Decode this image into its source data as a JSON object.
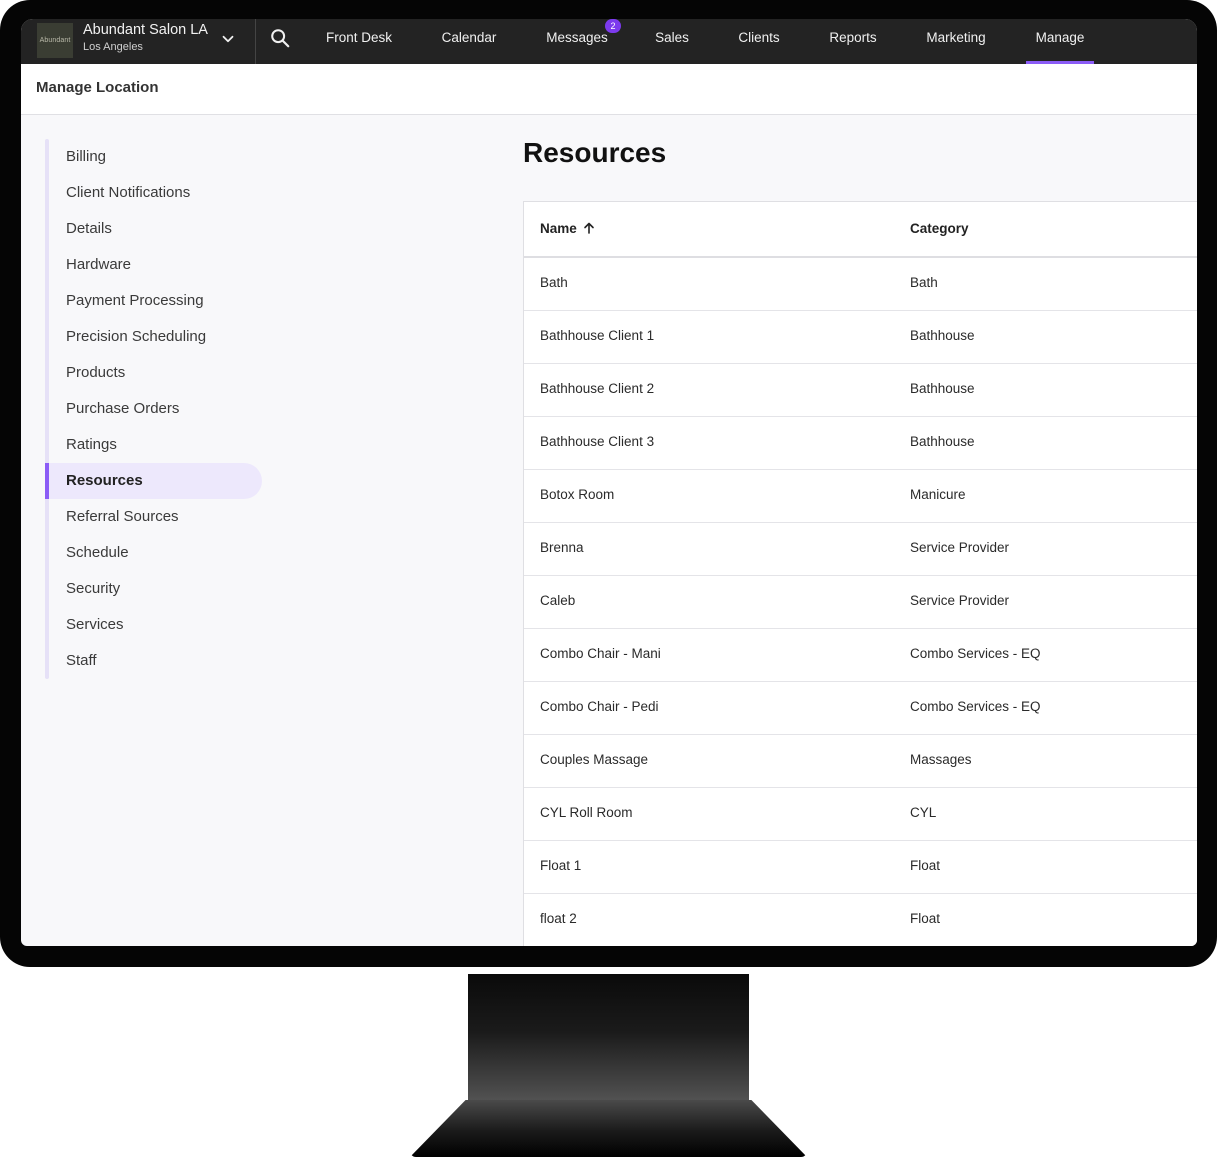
{
  "location": {
    "logo_text": "Abundant",
    "name": "Abundant Salon LA",
    "city": "Los Angeles"
  },
  "nav": {
    "items": [
      {
        "label": "Front Desk"
      },
      {
        "label": "Calendar"
      },
      {
        "label": "Messages",
        "badge": "2"
      },
      {
        "label": "Sales"
      },
      {
        "label": "Clients"
      },
      {
        "label": "Reports"
      },
      {
        "label": "Marketing"
      },
      {
        "label": "Manage",
        "active": true
      }
    ]
  },
  "header": {
    "title": "Manage Location"
  },
  "sidebar": {
    "items": [
      {
        "label": "Billing"
      },
      {
        "label": "Client Notifications"
      },
      {
        "label": "Details"
      },
      {
        "label": "Hardware"
      },
      {
        "label": "Payment Processing"
      },
      {
        "label": "Precision Scheduling"
      },
      {
        "label": "Products"
      },
      {
        "label": "Purchase Orders"
      },
      {
        "label": "Ratings"
      },
      {
        "label": "Resources",
        "active": true
      },
      {
        "label": "Referral Sources"
      },
      {
        "label": "Schedule"
      },
      {
        "label": "Security"
      },
      {
        "label": "Services"
      },
      {
        "label": "Staff"
      }
    ]
  },
  "main": {
    "title": "Resources",
    "table": {
      "columns": [
        "Name",
        "Category"
      ],
      "sort_icon": "arrow-up-icon",
      "rows": [
        [
          "Bath",
          "Bath"
        ],
        [
          "Bathhouse Client 1",
          "Bathhouse"
        ],
        [
          "Bathhouse Client 2",
          "Bathhouse"
        ],
        [
          "Bathhouse Client 3",
          "Bathhouse"
        ],
        [
          "Botox Room",
          "Manicure"
        ],
        [
          "Brenna",
          "Service Provider"
        ],
        [
          "Caleb",
          "Service Provider"
        ],
        [
          "Combo Chair - Mani",
          "Combo Services - EQ"
        ],
        [
          "Combo Chair - Pedi",
          "Combo Services - EQ"
        ],
        [
          "Couples Massage",
          "Massages"
        ],
        [
          "CYL Roll Room",
          "CYL"
        ],
        [
          "Float 1",
          "Float"
        ],
        [
          "float 2",
          "Float"
        ]
      ]
    }
  },
  "colors": {
    "accent": "#8b5cf6",
    "nav_bg": "#232323",
    "active_bg": "#ede8fc"
  }
}
